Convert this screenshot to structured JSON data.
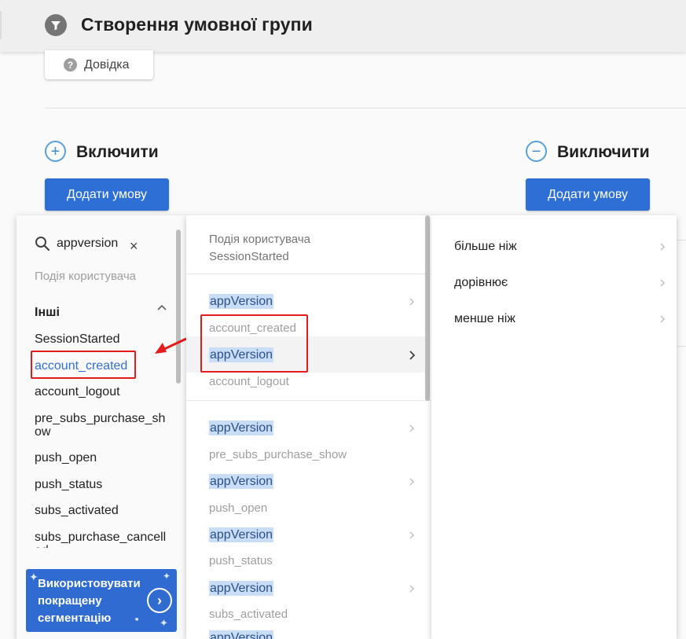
{
  "header": {
    "title": "Створення умовної групи",
    "help_label": "Довідка"
  },
  "include": {
    "title": "Включити",
    "add_button": "Додати умову"
  },
  "exclude": {
    "title": "Виключити",
    "add_button": "Додати умову"
  },
  "events_panel": {
    "search_value": "appversion",
    "hint": "Подія користувача",
    "group_label": "Інші",
    "items": [
      {
        "label": "SessionStarted"
      },
      {
        "label": "account_created"
      },
      {
        "label": "account_logout"
      },
      {
        "label": "pre_subs_purchase_show"
      },
      {
        "label": "push_open"
      },
      {
        "label": "push_status"
      },
      {
        "label": "subs_activated"
      },
      {
        "label": "subs_purchase_cancelled"
      }
    ],
    "promo_text": "Використовувати покращену сегментацію"
  },
  "properties_panel": {
    "header_line1": "Подія користувача",
    "header_line2": "SessionStarted",
    "rows": [
      {
        "property": "appVersion",
        "event": "account_created"
      },
      {
        "property": "appVersion",
        "event": "account_logout"
      },
      {
        "property": "appVersion",
        "event": "pre_subs_purchase_show"
      },
      {
        "property": "appVersion",
        "event": "push_open"
      },
      {
        "property": "appVersion",
        "event": "push_status"
      },
      {
        "property": "appVersion",
        "event": "subs_activated"
      },
      {
        "property": "appVersion",
        "event": ""
      }
    ],
    "first_property": "appVersion"
  },
  "operators_panel": {
    "items": [
      "більше ніж",
      "дорівнює",
      "менше ніж"
    ]
  },
  "colors": {
    "accent": "#2e6fd6",
    "highlight_box": "#e31b1b",
    "property_highlight": "#c9ddf6"
  }
}
